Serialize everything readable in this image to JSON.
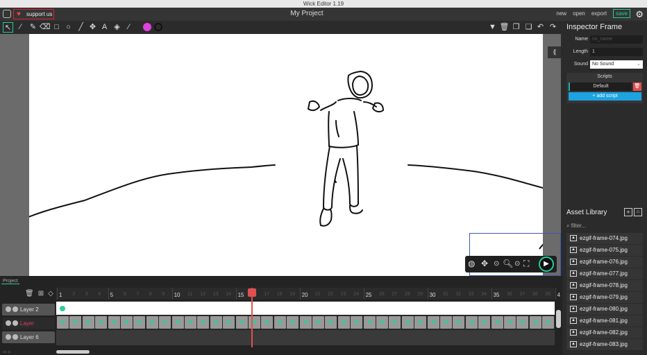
{
  "window": {
    "title": "Wick Editor 1.19"
  },
  "menubar": {
    "support_label": "support us",
    "project_title": "My Project",
    "links": {
      "new": "new",
      "open": "open",
      "export": "export",
      "save": "save"
    }
  },
  "toolbar": {
    "fill_color": "#e040e0",
    "stroke_color": "#111111",
    "tools": [
      "cursor-icon",
      "brush-icon",
      "pencil-icon",
      "eraser-icon",
      "rectangle-icon",
      "ellipse-icon",
      "line-icon",
      "pan-icon",
      "text-icon",
      "fill-bucket-icon",
      "eyedropper-icon"
    ],
    "right_actions": [
      "dropdown-icon",
      "trash-icon",
      "copy-icon",
      "paste-icon",
      "undo-icon",
      "redo-icon"
    ]
  },
  "inspector": {
    "title": "Inspector Frame",
    "name_label": "Name",
    "name_placeholder": "no_name",
    "length_label": "Length",
    "length_value": "1",
    "sound_label": "Sound",
    "sound_value": "No Sound",
    "scripts_title": "Scripts",
    "default_script": "Default",
    "add_script": "+ add script"
  },
  "assets": {
    "title": "Asset Library",
    "filter_placeholder": "filter...",
    "items": [
      "ezgif-frame-074.jpg",
      "ezgif-frame-075.jpg",
      "ezgif-frame-076.jpg",
      "ezgif-frame-077.jpg",
      "ezgif-frame-078.jpg",
      "ezgif-frame-079.jpg",
      "ezgif-frame-080.jpg",
      "ezgif-frame-081.jpg",
      "ezgif-frame-082.jpg",
      "ezgif-frame-083.jpg"
    ]
  },
  "timeline": {
    "tab": "Project",
    "layers": [
      "Layer 2",
      "Layer",
      "Layer 6"
    ],
    "current_frame": 16,
    "major_ticks": [
      "1",
      "5",
      "10",
      "15",
      "20",
      "25",
      "30",
      "35",
      "4"
    ],
    "minor_ticks": [
      "2",
      "3",
      "4",
      "6",
      "7",
      "8",
      "9",
      "11",
      "12",
      "13",
      "14",
      "16",
      "17",
      "18",
      "19",
      "21",
      "22",
      "23",
      "24",
      "26",
      "27",
      "28",
      "29",
      "31",
      "32",
      "33",
      "34",
      "36",
      "37",
      "38",
      "39"
    ]
  }
}
